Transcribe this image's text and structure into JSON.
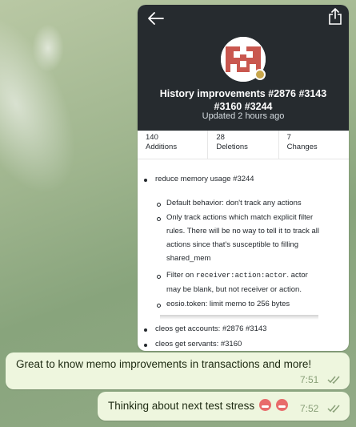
{
  "card": {
    "title": "History improvements #2876 #3143 #3160 #3244",
    "title_line1": "History improvements #2876 #3143",
    "title_line2": "#3160 #3244",
    "updated": "Updated 2 hours ago",
    "stats": [
      {
        "value": "140",
        "label": "Additions"
      },
      {
        "value": "28",
        "label": "Deletions"
      },
      {
        "value": "7",
        "label": "Changes"
      }
    ],
    "list": {
      "item1": "reduce memory usage #3244",
      "sub1": "Default behavior: don't track any actions",
      "sub2_l1": "Only track actions which match explicit filter",
      "sub2_l2": "rules. There will be no way to tell it to track all",
      "sub2_l3": "actions since that's susceptible to filling",
      "sub2_l4": "shared_mem",
      "sub3_pre": "Filter on ",
      "sub3_code": "receiver:action:actor",
      "sub3_post": ". actor",
      "sub3_l2": "may be blank, but not receiver or action.",
      "sub4": "eosio.token: limit memo to 256 bytes",
      "item2": "cleos get accounts: #2876 #3143",
      "item3": "cleos get servants: #3160"
    }
  },
  "messages": [
    {
      "text": "Great to know memo improvements in transactions and more!",
      "time": "7:51"
    },
    {
      "text": "Thinking about next test stress",
      "time": "7:52"
    }
  ],
  "colors": {
    "card_header": "#262b2f",
    "bubble": "#eef6de",
    "time": "#8aa079",
    "avatar_red": "#c9574f"
  }
}
